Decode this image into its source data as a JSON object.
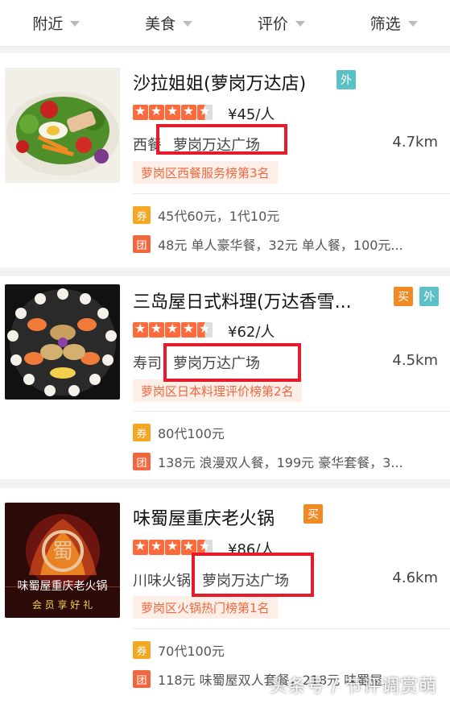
{
  "filters": [
    {
      "label": "附近"
    },
    {
      "label": "美食"
    },
    {
      "label": "评价"
    },
    {
      "label": "筛选"
    }
  ],
  "shops": [
    {
      "name": "沙拉姐姐(萝岗万达店)",
      "badges": [
        "外"
      ],
      "rating": 4.5,
      "price": "¥45/人",
      "category": "西餐",
      "area": "萝岗万达广场",
      "distance": "4.7km",
      "rank": "萝岗区西餐服务榜第3名",
      "deals": [
        {
          "tag": "券",
          "text": "45代60元，1代10元"
        },
        {
          "tag": "团",
          "text": "48元 单人豪华餐，32元 单人餐，100元..."
        }
      ]
    },
    {
      "name": "三岛屋日式料理(万达香雪...",
      "badges": [
        "买",
        "外"
      ],
      "rating": 4.5,
      "price": "¥62/人",
      "category": "寿司",
      "area": "萝岗万达广场",
      "distance": "4.5km",
      "rank": "萝岗区日本料理评价榜第2名",
      "deals": [
        {
          "tag": "券",
          "text": "80代100元"
        },
        {
          "tag": "团",
          "text": "138元 浪漫双人餐，199元 豪华套餐，3..."
        }
      ]
    },
    {
      "name": "味蜀屋重庆老火锅",
      "badges": [
        "买"
      ],
      "rating": 4.5,
      "price": "¥86/人",
      "category": "川味火锅",
      "area": "萝岗万达广场",
      "distance": "4.6km",
      "rank": "萝岗区火锅热门榜第1名",
      "logo_text": "味蜀屋重庆老火锅",
      "logo_slogan": "会 员 享 好 礼",
      "deals": [
        {
          "tag": "券",
          "text": "70代100元"
        },
        {
          "tag": "团",
          "text": "118元 味蜀屋双人套餐，218元 味蜀屋..."
        }
      ]
    }
  ],
  "watermark": "头条号 / 节评调赏萌",
  "colors": {
    "accent": "#ff6a3c",
    "highlight_box": "#e51a2a",
    "takeout": "#5cc1c6",
    "buy": "#f08a25"
  }
}
